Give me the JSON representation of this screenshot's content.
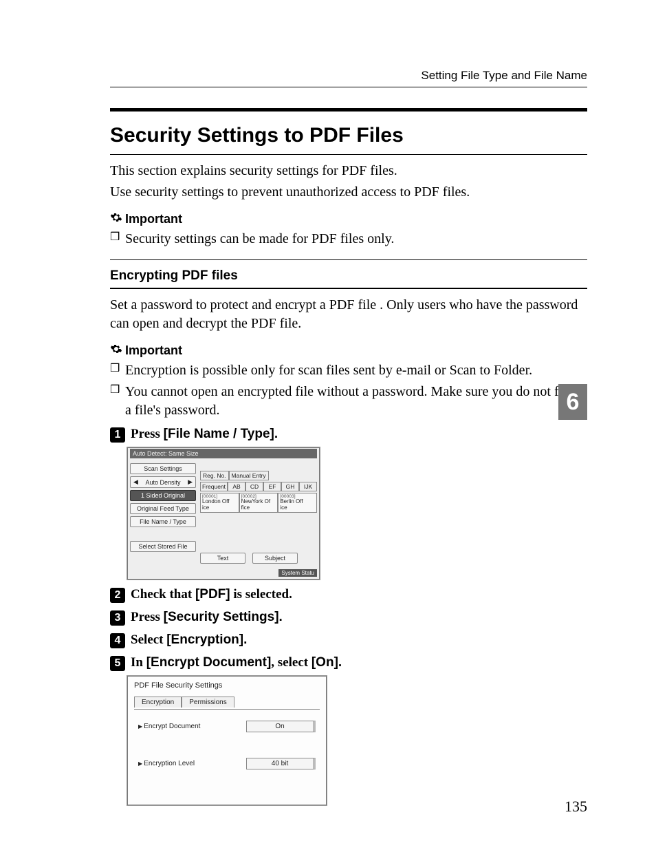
{
  "header": {
    "running": "Setting File Type and File Name"
  },
  "h2": "Security Settings to PDF Files",
  "intro": [
    "This section explains security settings for PDF files.",
    "Use security settings to prevent unauthorized access to PDF files."
  ],
  "important_label": "Important",
  "important1": [
    "Security settings can be made for PDF files only."
  ],
  "h3": "Encrypting PDF files",
  "encrypt_intro": "Set a password to protect and encrypt a PDF file . Only users who have the password can open and decrypt the PDF file.",
  "important2": [
    "Encryption is possible only for scan files sent by e-mail or Scan to Folder.",
    "You cannot open an encrypted file without a password. Make sure you do not forget a file's password."
  ],
  "steps": [
    {
      "n": "1",
      "pre": "Press ",
      "label": "[File Name / Type]",
      "post": "."
    },
    {
      "n": "2",
      "pre": "Check that ",
      "label": "[PDF]",
      "post": " is selected."
    },
    {
      "n": "3",
      "pre": "Press ",
      "label": "[Security Settings]",
      "post": "."
    },
    {
      "n": "4",
      "pre": "Select ",
      "label": "[Encryption]",
      "post": "."
    },
    {
      "n": "5",
      "pre": "In ",
      "label": "[Encrypt Document]",
      "mid": ", select ",
      "label2": "[On]",
      "post": "."
    }
  ],
  "shot1": {
    "top": "Auto Detect: Same Size",
    "left_buttons": {
      "scan": "Scan Settings",
      "density": "Auto Density",
      "sided": "1 Sided Original",
      "feed": "Original Feed Type",
      "fname": "File Name / Type",
      "stored": "Select Stored File"
    },
    "tabs": {
      "reg": "Reg. No.",
      "manual": "Manual Entry"
    },
    "letters": [
      "Frequent",
      "AB",
      "CD",
      "EF",
      "GH",
      "IJK"
    ],
    "addr": [
      {
        "code": "[00001]",
        "l1": "London Off",
        "l2": "ice"
      },
      {
        "code": "[00002]",
        "l1": "NewYork Of",
        "l2": "fice"
      },
      {
        "code": "[00003]",
        "l1": "Berlin Off",
        "l2": "ice"
      }
    ],
    "bottom": {
      "text": "Text",
      "subject": "Subject"
    },
    "footer": "System Statu"
  },
  "shot2": {
    "title": "PDF File Security Settings",
    "tabs": {
      "enc": "Encryption",
      "perm": "Permissions"
    },
    "rows": [
      {
        "k": "Encrypt Document",
        "v": "On"
      },
      {
        "k": "Encryption Level",
        "v": "40 bit"
      }
    ]
  },
  "side_tab": "6",
  "page_number": "135"
}
